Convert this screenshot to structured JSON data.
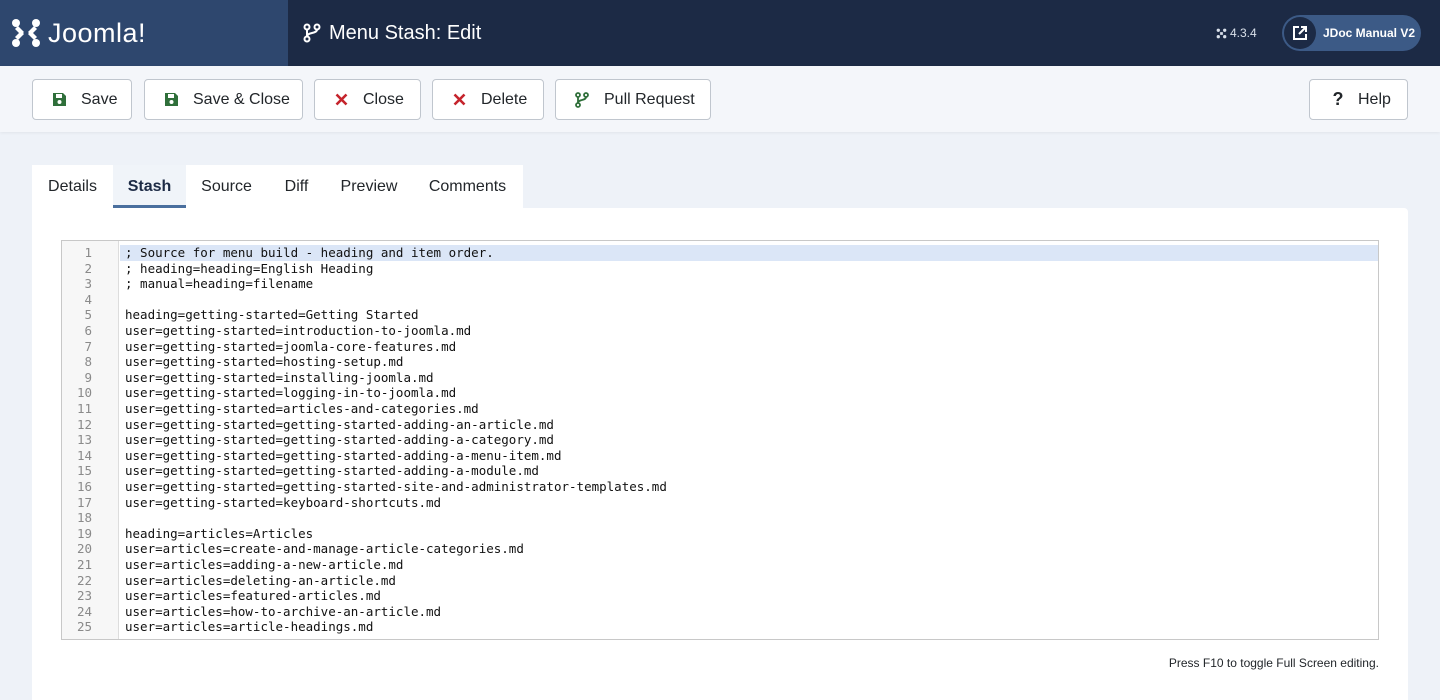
{
  "header": {
    "brand": "Joomla!",
    "title": "Menu Stash: Edit",
    "version": "4.3.4",
    "manual_link": "JDoc Manual V2"
  },
  "toolbar": {
    "save": "Save",
    "save_close": "Save & Close",
    "close": "Close",
    "delete": "Delete",
    "pull_request": "Pull Request",
    "help": "Help"
  },
  "tabs": [
    "Details",
    "Stash",
    "Source",
    "Diff",
    "Preview",
    "Comments"
  ],
  "active_tab": "Stash",
  "editor": {
    "lines": [
      "; Source for menu build - heading and item order.",
      "; heading=heading=English Heading",
      "; manual=heading=filename",
      "",
      "heading=getting-started=Getting Started",
      "user=getting-started=introduction-to-joomla.md",
      "user=getting-started=joomla-core-features.md",
      "user=getting-started=hosting-setup.md",
      "user=getting-started=installing-joomla.md",
      "user=getting-started=logging-in-to-joomla.md",
      "user=getting-started=articles-and-categories.md",
      "user=getting-started=getting-started-adding-an-article.md",
      "user=getting-started=getting-started-adding-a-category.md",
      "user=getting-started=getting-started-adding-a-menu-item.md",
      "user=getting-started=getting-started-adding-a-module.md",
      "user=getting-started=getting-started-site-and-administrator-templates.md",
      "user=getting-started=keyboard-shortcuts.md",
      "",
      "heading=articles=Articles",
      "user=articles=create-and-manage-article-categories.md",
      "user=articles=adding-a-new-article.md",
      "user=articles=deleting-an-article.md",
      "user=articles=featured-articles.md",
      "user=articles=how-to-archive-an-article.md",
      "user=articles=article-headings.md"
    ]
  },
  "hint": "Press F10 to toggle Full Screen editing.",
  "colors": {
    "header_bg": "#1c2a45",
    "brand_bg": "#2e476e",
    "accent": "#4a6f9e",
    "save_icon": "#2f6f3a",
    "close_icon": "#c5242c"
  }
}
